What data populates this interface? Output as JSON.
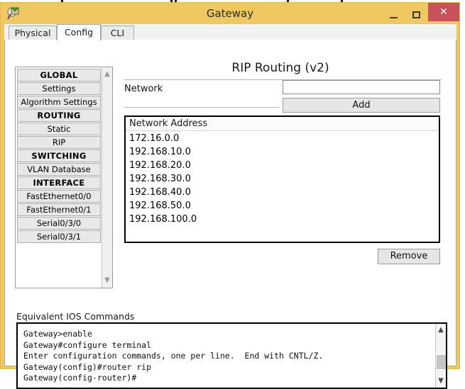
{
  "window": {
    "title": "Gateway",
    "icon": "packet-tracer-icon",
    "titlebar_color": "#EFC862",
    "close_button_color": "#C8525A",
    "controls": {
      "minimize": "—",
      "maximize": "□",
      "close": "✕"
    }
  },
  "tabs": [
    {
      "label": "Physical",
      "active": false
    },
    {
      "label": "Config",
      "active": true
    },
    {
      "label": "CLI",
      "active": false
    }
  ],
  "sidebar": {
    "items": [
      {
        "label": "GLOBAL",
        "type": "header"
      },
      {
        "label": "Settings",
        "type": "item"
      },
      {
        "label": "Algorithm Settings",
        "type": "item"
      },
      {
        "label": "ROUTING",
        "type": "header"
      },
      {
        "label": "Static",
        "type": "item"
      },
      {
        "label": "RIP",
        "type": "item"
      },
      {
        "label": "SWITCHING",
        "type": "header"
      },
      {
        "label": "VLAN Database",
        "type": "item"
      },
      {
        "label": "INTERFACE",
        "type": "header"
      },
      {
        "label": "FastEthernet0/0",
        "type": "item"
      },
      {
        "label": "FastEthernet0/1",
        "type": "item"
      },
      {
        "label": "Serial0/3/0",
        "type": "item"
      },
      {
        "label": "Serial0/3/1",
        "type": "item"
      }
    ],
    "scroll_up": "▲",
    "scroll_down": "▼"
  },
  "config": {
    "title": "RIP Routing (v2)",
    "network_label": "Network",
    "network_value": "",
    "network_placeholder": "",
    "add_label": "Add",
    "remove_label": "Remove",
    "list_header": "Network Address",
    "networks": [
      "172.16.0.0",
      "192.168.10.0",
      "192.168.20.0",
      "192.168.30.0",
      "192.168.40.0",
      "192.168.50.0",
      "192.168.100.0"
    ]
  },
  "ios": {
    "label": "Equivalent IOS Commands",
    "lines": [
      "Gateway>enable",
      "Gateway#configure terminal",
      "Enter configuration commands, one per line.  End with CNTL/Z.",
      "Gateway(config)#router rip",
      "Gateway(config-router)#"
    ],
    "scroll_up": "▲",
    "scroll_down": "▼"
  }
}
